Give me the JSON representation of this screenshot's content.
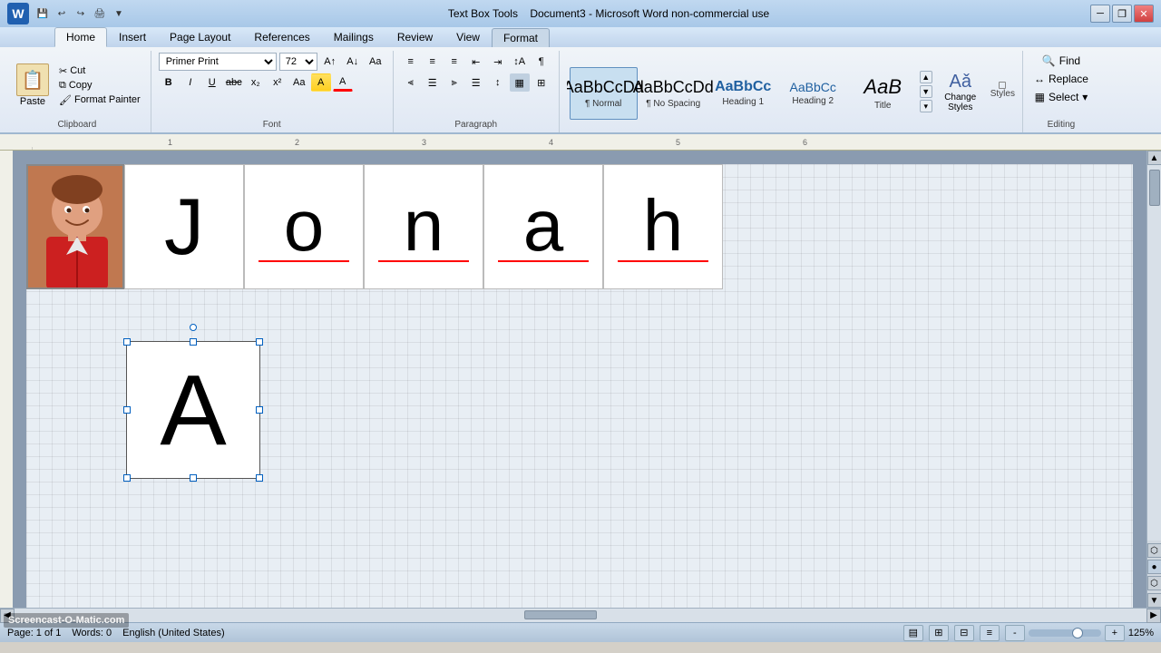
{
  "app": {
    "title": "Document3 - Microsoft Word non-commercial use",
    "context_tab": "Text Box Tools"
  },
  "titlebar": {
    "word_icon": "W",
    "quick_access": [
      "save",
      "undo",
      "redo",
      "print"
    ],
    "minimize_label": "─",
    "restore_label": "❐",
    "close_label": "✕"
  },
  "ribbon_tabs": {
    "tabs": [
      "Home",
      "Insert",
      "Page Layout",
      "References",
      "Mailings",
      "Review",
      "View",
      "Format"
    ],
    "active": "Home"
  },
  "ribbon": {
    "clipboard": {
      "paste_label": "Paste",
      "cut_label": "Cut",
      "copy_label": "Copy",
      "format_painter_label": "Format Painter"
    },
    "font": {
      "font_name": "Primer Print",
      "font_size": "72",
      "bold_label": "B",
      "italic_label": "I",
      "underline_label": "U",
      "strikethrough_label": "abc",
      "superscript_label": "x²",
      "subscript_label": "x₂",
      "font_color_label": "A",
      "highlight_label": "A"
    },
    "paragraph": {
      "bullets_label": "≡",
      "numbering_label": "≡",
      "decrease_indent_label": "←",
      "increase_indent_label": "→"
    },
    "styles": {
      "items": [
        {
          "id": "normal",
          "preview": "AaBbCcDd",
          "label": "¶ Normal",
          "active": true
        },
        {
          "id": "no-spacing",
          "preview": "AaBbCcDd",
          "label": "¶ No Spacing",
          "active": false
        },
        {
          "id": "heading1",
          "preview": "AaBbCc",
          "label": "Heading 1",
          "active": false
        },
        {
          "id": "heading2",
          "preview": "AaBbCc",
          "label": "Heading 2",
          "active": false
        },
        {
          "id": "title",
          "preview": "AaB",
          "label": "Title",
          "active": false
        }
      ],
      "change_styles_label": "Change Styles",
      "group_label": "Styles"
    },
    "editing": {
      "find_label": "Find",
      "replace_label": "Replace",
      "select_label": "Select",
      "group_label": "Editing"
    }
  },
  "document": {
    "photo_alt": "Child photo",
    "letters": [
      "J",
      "o",
      "n",
      "a",
      "h"
    ],
    "text_box_letter": "A"
  },
  "statusbar": {
    "page_info": "Page: 1 of 1",
    "words": "Words: 0",
    "language": "English (United States)",
    "zoom": "125%"
  },
  "watermark": {
    "text": "Screencast-O-Matic.com"
  }
}
